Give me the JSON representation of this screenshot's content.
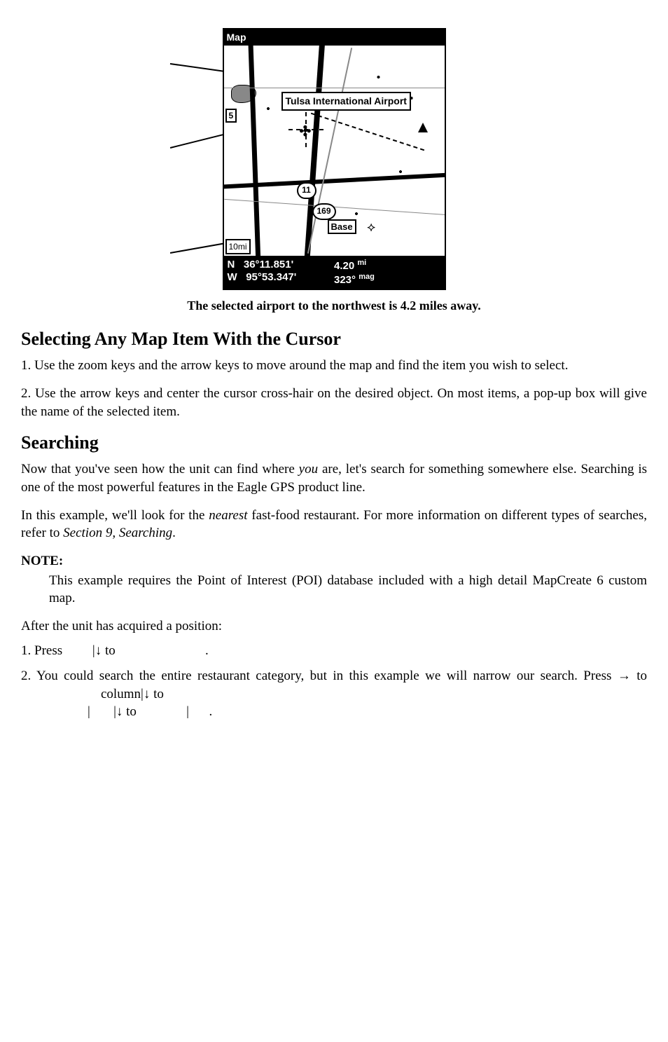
{
  "figure": {
    "titlebar": "Map",
    "popup": "Tulsa International Airport",
    "hwy_shield_top": "11",
    "hwy_shield_bottom": "169",
    "base_label": "Base",
    "zoom_corner": "10mi",
    "zoom_left": "5",
    "status": {
      "n_label": "N",
      "w_label": "W",
      "lat": "36°11.851'",
      "lon": "95°53.347'",
      "dist": "4.20",
      "dist_unit": "mi",
      "brg": "323°",
      "brg_unit": "mag"
    }
  },
  "caption": "The selected airport to the northwest is 4.2 miles away.",
  "section1_heading": "Selecting Any Map Item With the Cursor",
  "section1_p1": "1. Use the zoom keys and the arrow keys to move around the map and find the item you wish to select.",
  "section1_p2": "2. Use the arrow keys and center the cursor cross-hair on the desired object. On most items, a pop-up box will give the name of the selected item.",
  "section2_heading": "Searching",
  "section2_p1_a": "Now that you've seen how the unit can find where ",
  "section2_p1_you": "you",
  "section2_p1_b": " are, let's search for something somewhere else. Searching is one of the most powerful features in the Eagle GPS product line.",
  "section2_p2_a": "In this example, we'll look for the ",
  "section2_p2_nearest": "nearest",
  "section2_p2_b": " fast-food restaurant. For more information on different types of searches, refer to ",
  "section2_p2_sec9": "Section 9, Searching",
  "section2_p2_c": ".",
  "note_head": "NOTE:",
  "note_body": "This example requires the Point of Interest (POI) database included with a high detail MapCreate 6 custom map.",
  "after_pos": "After the unit has acquired a position:",
  "step1_a": "1. Press ",
  "step1_b": "|",
  "step1_c": " to ",
  "step1_d": ".",
  "step2_a": "2. You could search the entire restaurant category, but in this example we will narrow our search. Press ",
  "step2_b": " to ",
  "step2_c": "column",
  "step2_d": "|",
  "step2_e": " to ",
  "step2_f": "|",
  "step2_g": "|",
  "step2_h": " to ",
  "step2_i": "|",
  "step2_j": ".",
  "arrows": {
    "down": "↓",
    "right": "→"
  }
}
